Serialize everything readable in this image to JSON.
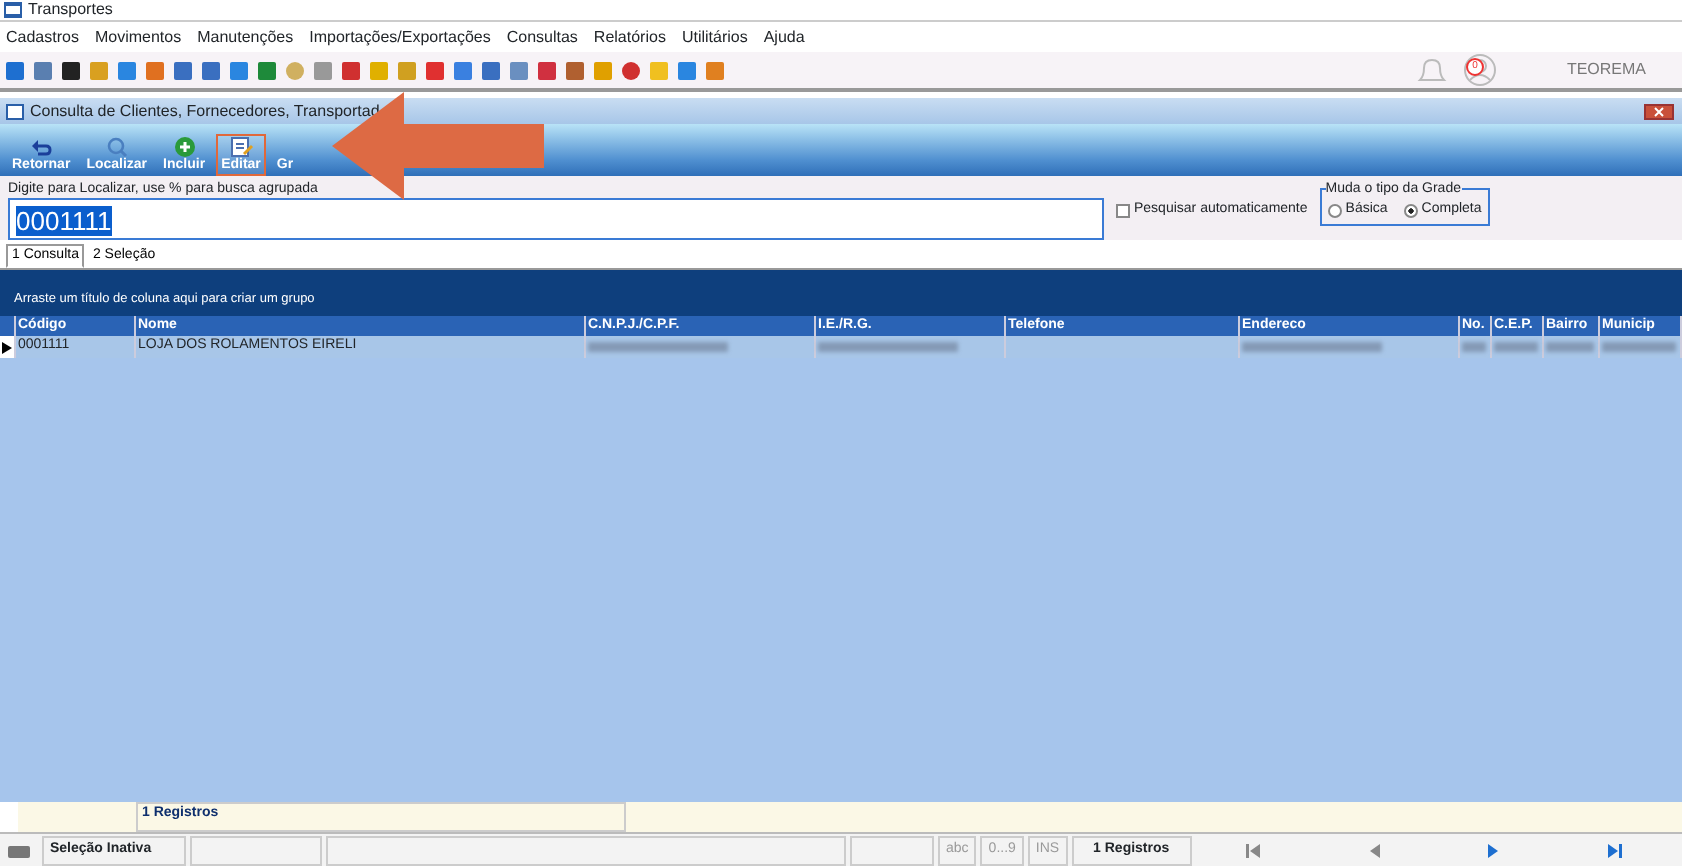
{
  "window": {
    "title": "Transportes"
  },
  "menu": [
    "Cadastros",
    "Movimentos",
    "Manutenções",
    "Importações/Exportações",
    "Consultas",
    "Relatórios",
    "Utilitários",
    "Ajuda"
  ],
  "notifications": {
    "count": "0"
  },
  "user": "TEOREMA",
  "subwindow": {
    "title": "Consulta de Clientes, Fornecedores, Transportad"
  },
  "actions": [
    {
      "label": "Retornar",
      "selected": false
    },
    {
      "label": "Localizar",
      "selected": false
    },
    {
      "label": "Incluir",
      "selected": false
    },
    {
      "label": "Editar",
      "selected": true
    },
    {
      "label": "Gr",
      "selected": false
    }
  ],
  "search": {
    "legend": "Digite para Localizar, use % para busca agrupada",
    "value": "0001111"
  },
  "auto_search": {
    "label": "Pesquisar automaticamente",
    "checked": false
  },
  "grid_type": {
    "legend": "Muda o tipo da Grade",
    "options": [
      {
        "label": "Básica",
        "selected": false
      },
      {
        "label": "Completa",
        "selected": true
      }
    ]
  },
  "tabs": [
    {
      "label": "1 Consulta",
      "selected": true
    },
    {
      "label": "2 Seleção",
      "selected": false
    }
  ],
  "group_hint": "Arraste um título de coluna aqui para criar um grupo",
  "table": {
    "columns": [
      "Código",
      "Nome",
      "C.N.P.J./C.P.F.",
      "I.E./R.G.",
      "Telefone",
      "Endereco",
      "No.",
      "C.E.P.",
      "Bairro",
      "Municip"
    ],
    "rows": [
      {
        "selected": true,
        "cells": [
          {
            "text": "0001111"
          },
          {
            "text": "LOJA DOS ROLAMENTOS EIRELI"
          },
          {
            "redacted": true
          },
          {
            "redacted": true
          },
          {
            "text": ""
          },
          {
            "redacted": true
          },
          {
            "redacted": true
          },
          {
            "redacted": true
          },
          {
            "redacted": true
          },
          {
            "redacted": true
          }
        ]
      }
    ]
  },
  "footer_count": "1 Registros",
  "status_bar": {
    "selection": "Seleção Inativa",
    "indicators": [
      "abc",
      "0...9",
      "INS"
    ],
    "count": "1 Registros"
  }
}
